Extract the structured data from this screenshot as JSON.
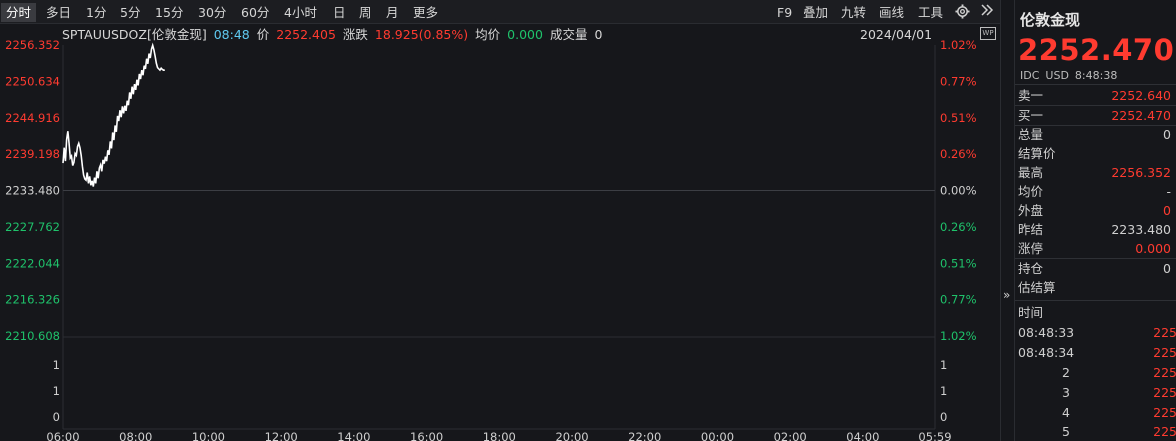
{
  "toolbar": {
    "periods": [
      "分时",
      "多日",
      "1分",
      "5分",
      "15分",
      "30分",
      "60分",
      "4小时",
      "日",
      "周",
      "月",
      "更多"
    ],
    "active_period": "分时",
    "tools": [
      "F9",
      "叠加",
      "九转",
      "画线",
      "工具"
    ]
  },
  "info_bar": {
    "symbol": "SPTAUUSDOZ[伦敦金现]",
    "time": "08:48",
    "price_label": "价",
    "price": "2252.405",
    "change_label": "涨跌",
    "change": "18.925(0.85%)",
    "avg_label": "均价",
    "avg": "0.000",
    "volume_label": "成交量",
    "volume": "0",
    "date": "2024/04/01"
  },
  "chart_data": {
    "type": "line",
    "y_left_ticks": [
      "2256.352",
      "2250.634",
      "2244.916",
      "2239.198",
      "2233.480",
      "2227.762",
      "2222.044",
      "2216.326",
      "2210.608"
    ],
    "y_right_ticks": [
      "1.02%",
      "0.77%",
      "0.51%",
      "0.26%",
      "0.00%",
      "0.26%",
      "0.51%",
      "0.77%",
      "1.02%"
    ],
    "ylim": [
      2210.608,
      2256.352
    ],
    "prev_close": 2233.48,
    "volume_ticks": [
      "1",
      "1",
      "0"
    ],
    "x_ticks": [
      "06:00",
      "08:00",
      "10:00",
      "12:00",
      "14:00",
      "16:00",
      "18:00",
      "20:00",
      "22:00",
      "00:00",
      "02:00",
      "04:00",
      "05:59"
    ],
    "x_range_minutes": [
      0,
      1439
    ],
    "series": [
      {
        "x": [
          0,
          2,
          4,
          6,
          8,
          10,
          12,
          14,
          16,
          18,
          20,
          22,
          24,
          26,
          28,
          30,
          32,
          34,
          36,
          38,
          40,
          42,
          44,
          46,
          48,
          50,
          52,
          54,
          56,
          58,
          60,
          62,
          64,
          66,
          68,
          70,
          72,
          74,
          76,
          78,
          80,
          82,
          84,
          86,
          88,
          90,
          92,
          94,
          96,
          98,
          100,
          102,
          104,
          106,
          108,
          110,
          112,
          114,
          116,
          118,
          120,
          122,
          124,
          126,
          128,
          130,
          132,
          134,
          136,
          138,
          140,
          142,
          144,
          146,
          148,
          150,
          152,
          154,
          156,
          158,
          160,
          162,
          164,
          166,
          168
        ],
        "values": [
          2237.8,
          2240.2,
          2238.1,
          2241.5,
          2242.8,
          2240.9,
          2238.6,
          2238.9,
          2237.4,
          2237.9,
          2239.3,
          2239.0,
          2240.4,
          2240.9,
          2240.2,
          2239.0,
          2237.3,
          2235.9,
          2235.3,
          2235.1,
          2236.3,
          2234.6,
          2235.7,
          2234.3,
          2235.0,
          2234.1,
          2235.5,
          2234.6,
          2236.5,
          2235.4,
          2237.0,
          2237.5,
          2236.5,
          2238.3,
          2237.7,
          2238.8,
          2238.1,
          2239.8,
          2239.1,
          2241.2,
          2240.1,
          2242.6,
          2241.4,
          2243.7,
          2242.7,
          2245.2,
          2244.4,
          2246.1,
          2245.0,
          2246.7,
          2245.6,
          2246.8,
          2246.0,
          2247.6,
          2246.9,
          2248.9,
          2247.9,
          2249.8,
          2248.6,
          2250.2,
          2249.3,
          2250.9,
          2250.0,
          2251.8,
          2251.0,
          2252.4,
          2251.6,
          2253.1,
          2252.6,
          2254.2,
          2253.4,
          2255.0,
          2254.3,
          2255.7,
          2256.3,
          2255.6,
          2254.6,
          2253.5,
          2252.8,
          2252.6,
          2252.4,
          2252.7,
          2252.5,
          2252.4,
          2252.4
        ]
      }
    ]
  },
  "side_panel": {
    "name": "伦敦金现",
    "price": "2252.470",
    "market": "IDC",
    "currency": "USD",
    "time": "8:48:38",
    "rows": [
      {
        "label": "卖一",
        "value": "2252.640",
        "color": "red"
      },
      {
        "label": "买一",
        "value": "2252.470",
        "color": "red"
      },
      {
        "label": "总量",
        "value": "0",
        "color": ""
      },
      {
        "label": "结算价",
        "value": "",
        "color": ""
      },
      {
        "label": "最高",
        "value": "2256.352",
        "color": "red"
      },
      {
        "label": "均价",
        "value": "-",
        "color": ""
      },
      {
        "label": "外盘",
        "value": "0",
        "color": "red"
      },
      {
        "label": "昨结",
        "value": "2233.480",
        "color": ""
      },
      {
        "label": "涨停",
        "value": "0.000",
        "color": "red"
      },
      {
        "label": "持仓",
        "value": "0",
        "color": ""
      },
      {
        "label": "估结算",
        "value": "",
        "color": ""
      }
    ],
    "ticks_header": "时间",
    "ticks": [
      {
        "time": "08:48:33",
        "price": "225"
      },
      {
        "time": "08:48:34",
        "price": "225"
      },
      {
        "time": "2",
        "price": "225"
      },
      {
        "time": "3",
        "price": "225"
      },
      {
        "time": "4",
        "price": "225"
      },
      {
        "time": "5",
        "price": "225"
      }
    ],
    "expand_glyph": "»"
  },
  "colors": {
    "up": "#ff3b30",
    "down": "#1fc26b",
    "line": "#ffffff",
    "background": "#16171b"
  }
}
